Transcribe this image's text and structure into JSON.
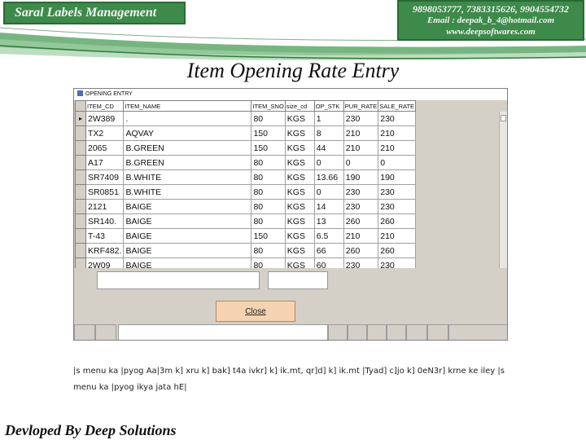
{
  "banner": {
    "title": "Saral Labels Management",
    "phones": "9898053777, 7383315626, 9904554732",
    "email": "Email : deepak_b_4@hotmail.com",
    "website": "www.deepsoftwares.com"
  },
  "page_title": "Item Opening Rate Entry",
  "window": {
    "title": "OPENING ENTRY",
    "columns": [
      "ITEM_CD",
      "ITEM_NAME",
      "ITEM_SNO",
      "size_cd",
      "OP_STK",
      "PUR_RATE",
      "SALE_RATE"
    ],
    "rows": [
      {
        "cells": [
          "2W389",
          ".",
          "80",
          "KGS",
          "1",
          "230",
          "230"
        ],
        "current": true
      },
      {
        "cells": [
          "TX2",
          "AQVAY",
          "150",
          "KGS",
          "8",
          "210",
          "210"
        ]
      },
      {
        "cells": [
          "2065",
          "B.GREEN",
          "150",
          "KGS",
          "44",
          "210",
          "210"
        ]
      },
      {
        "cells": [
          "A17",
          "B.GREEN",
          "80",
          "KGS",
          "0",
          "0",
          "0"
        ]
      },
      {
        "cells": [
          "SR7409",
          "B.WHITE",
          "80",
          "KGS",
          "13.66",
          "190",
          "190"
        ]
      },
      {
        "cells": [
          "SR0851",
          "B.WHITE",
          "80",
          "KGS",
          "0",
          "230",
          "230"
        ]
      },
      {
        "cells": [
          "2121",
          "BAIGE",
          "80",
          "KGS",
          "14",
          "230",
          "230"
        ]
      },
      {
        "cells": [
          "SR140.",
          "BAIGE",
          "80",
          "KGS",
          "13",
          "260",
          "260"
        ]
      },
      {
        "cells": [
          "T-43",
          "BAIGE",
          "150",
          "KGS",
          "6.5",
          "210",
          "210"
        ]
      },
      {
        "cells": [
          "KRF482.",
          "BAIGE",
          "80",
          "KGS",
          "66",
          "260",
          "260"
        ]
      },
      {
        "cells": [
          "2W09",
          "BAIGE",
          "80",
          "KGS",
          "60",
          "230",
          "230"
        ]
      }
    ],
    "close_label": "Close",
    "current_row_marker": "▸"
  },
  "description": "|s menu ka |pyog Aa|3m k] xru k] bak] t4a ivkr] k] ik.mt, qr]d] k] ik.mt |Tyad] c]jo k] 0eN3r] krne ke iley |s menu ka |pyog ikya jata hE|",
  "footer": "Devloped By Deep Solutions",
  "colors": {
    "banner_green": "#3d8a4a",
    "close_button": "#f6d3b0",
    "window_gray": "#d4d0c8"
  }
}
